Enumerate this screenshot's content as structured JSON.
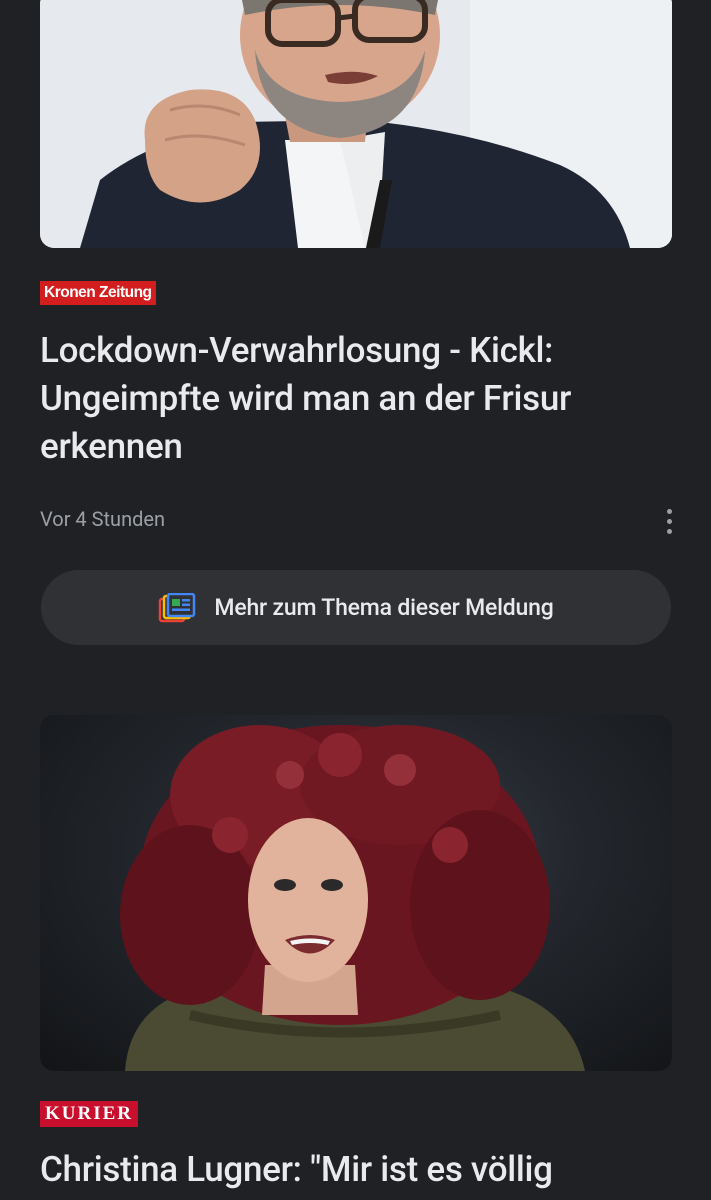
{
  "articles": [
    {
      "source": "Kronen Zeitung",
      "headline": "Lockdown-Verwahrlosung - Kickl: Ungeimpfte wird man an der Frisur erkennen",
      "time": "Vor 4 Stunden",
      "more_label": "Mehr zum Thema dieser Meldung"
    },
    {
      "source": "KURIER",
      "headline": "Christina Lugner: \"Mir ist es völlig"
    }
  ],
  "colors": {
    "background": "#202124",
    "krone_red": "#d21e1e",
    "kurier_red": "#c8102e",
    "button_bg": "#303134"
  },
  "icons": {
    "menu": "more-vert-icon",
    "coverage": "full-coverage-icon"
  }
}
